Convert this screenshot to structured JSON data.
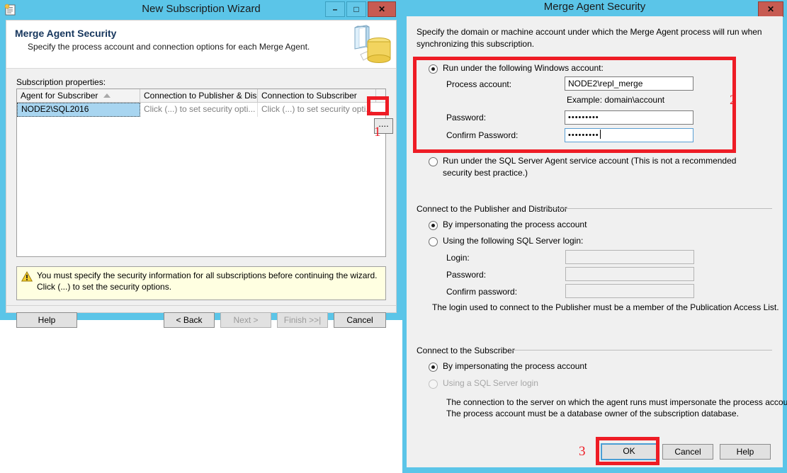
{
  "wizard": {
    "title": "New Subscription Wizard",
    "icon": "wizard-window-icon",
    "titlebar": {
      "minimize": "–",
      "maximize": "□",
      "close": "✕"
    },
    "header": {
      "heading": "Merge Agent Security",
      "subheading": "Specify the process account and connection options for each Merge Agent.",
      "banner_icon": "book-database-icon"
    },
    "grid_label": "Subscription properties:",
    "grid": {
      "columns": [
        "Agent for Subscriber",
        "Connection to Publisher & Dis...",
        "Connection to Subscriber",
        ""
      ],
      "sort_column": 0,
      "sort_direction": "ascending",
      "rows": [
        {
          "agent_for_subscriber": "NODE2\\SQL2016",
          "connection_to_publisher": "Click (...) to set security opti...",
          "connection_to_subscriber": "Click (...) to set security opti..."
        }
      ],
      "ellipsis_button": "...."
    },
    "warning": {
      "icon": "warning-triangle-icon",
      "text": "You must specify the security information for all subscriptions before continuing the wizard. Click (...) to set the security options."
    },
    "buttons": {
      "help": "Help",
      "back": "< Back",
      "next": "Next >",
      "finish": "Finish >>|",
      "cancel": "Cancel"
    }
  },
  "dialog": {
    "title": "Merge Agent Security",
    "close": "✕",
    "intro": "Specify the domain or machine account under which the Merge Agent process will run when synchronizing this subscription.",
    "windows_account": {
      "radio_label": "Run under the following Windows account:",
      "process_account_label": "Process account:",
      "process_account_value": "NODE2\\repl_merge",
      "example": "Example: domain\\account",
      "password_label": "Password:",
      "password_value": "•••••••••",
      "confirm_password_label": "Confirm Password:",
      "confirm_password_value": "•••••••••"
    },
    "sql_agent_account": {
      "radio_label": "Run under the SQL Server Agent service account (This is not a recommended security best practice.)"
    },
    "publisher_group": {
      "title": "Connect to the Publisher and Distributor",
      "option_impersonate": "By impersonating the process account",
      "option_sql_login": "Using the following SQL Server login:",
      "login_label": "Login:",
      "login_value": "",
      "password_label": "Password:",
      "password_value": "",
      "confirm_password_label": "Confirm password:",
      "confirm_password_value": "",
      "note": "The login used to connect to the Publisher must be a member of the Publication Access List."
    },
    "subscriber_group": {
      "title": "Connect to the Subscriber",
      "option_impersonate": "By impersonating the process account",
      "option_sql_login": "Using a SQL Server login",
      "note_line1": "The connection to the server on which the agent runs must impersonate the process account.",
      "note_line2": "The process account must be a database owner of the subscription database."
    },
    "buttons": {
      "ok": "OK",
      "cancel": "Cancel",
      "help": "Help"
    }
  },
  "annotations": {
    "one": "1",
    "two": "2",
    "three": "3"
  },
  "colors": {
    "titlebar": "#5bc5e8",
    "annotation_red": "#ee1c25",
    "dialog_face": "#f0f0f0",
    "selection_blue": "#a8d5f0",
    "warning_bg": "#ffffe1",
    "close_button": "#c75b52"
  }
}
